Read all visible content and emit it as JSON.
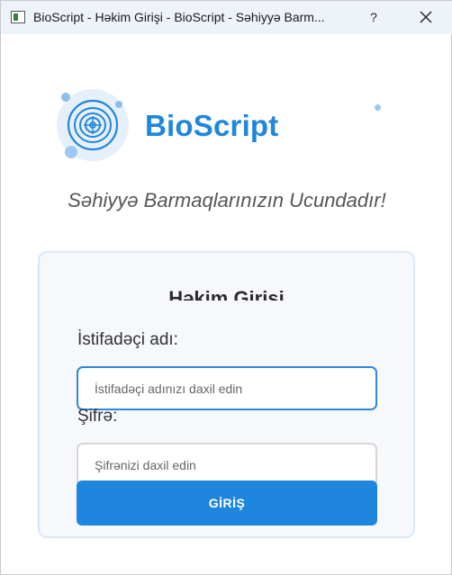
{
  "window": {
    "title": "BioScript - Həkim Girişi - BioScript - Səhiyyə Barm...",
    "help_label": "?"
  },
  "brand": {
    "name": "BioScript",
    "slogan": "Səhiyyə Barmaqlarınızın Ucundadır!",
    "accent_color": "#1f86dd"
  },
  "login_card": {
    "title": "Həkim Girişi",
    "username_label": "İstifadəçi adı:",
    "username_placeholder": "İstifadəçi adınızı daxil edin",
    "password_label": "Şifrə:",
    "password_placeholder": "Şifrənizi daxil edin",
    "submit_label": "GİRİŞ"
  },
  "icons": {
    "app": "app-window-icon",
    "logo": "fingerprint-logo-icon",
    "close": "close-icon"
  }
}
